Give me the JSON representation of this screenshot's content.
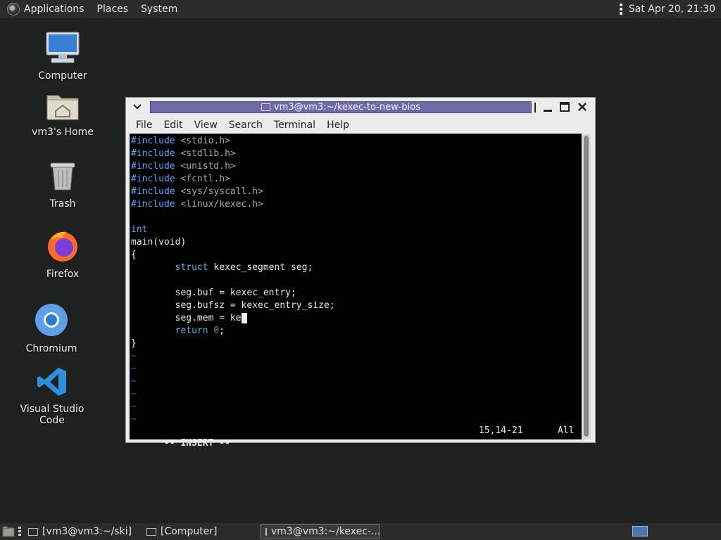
{
  "top_panel": {
    "menus": [
      "Applications",
      "Places",
      "System"
    ],
    "clock": "Sat Apr 20, 21:30"
  },
  "desktop_icons": [
    {
      "label": "Computer",
      "icon": "computer-icon"
    },
    {
      "label": "vm3's Home",
      "icon": "home-folder-icon"
    },
    {
      "label": "Trash",
      "icon": "trash-icon"
    },
    {
      "label": "Firefox",
      "icon": "firefox-icon"
    },
    {
      "label": "Chromium",
      "icon": "chromium-icon"
    },
    {
      "label": "Visual Studio Code",
      "icon": "vscode-icon"
    }
  ],
  "window": {
    "title": "vm3@vm3:~/kexec-to-new-bios",
    "menus": [
      "File",
      "Edit",
      "View",
      "Search",
      "Terminal",
      "Help"
    ]
  },
  "editor": {
    "includes": [
      "<stdio.h>",
      "<stdlib.h>",
      "<unistd.h>",
      "<fcntl.h>",
      "<sys/syscall.h>",
      "<linux/kexec.h>"
    ],
    "include_kw": "#include",
    "type_line": "int",
    "main_line": "main(void)",
    "open_brace": "{",
    "struct_kw": "struct",
    "struct_rest": " kexec_segment seg;",
    "assign_buf": "seg.buf = kexec_entry;",
    "assign_bufsz": "seg.bufsz = kexec_entry_size;",
    "assign_mem_typed": "seg.mem = ke",
    "return_kw": "return",
    "return_val": "0",
    "return_end": ";",
    "close_brace": "}",
    "tilde": "~",
    "mode": "-- INSERT --",
    "position": "15,14-21",
    "scroll": "All"
  },
  "bottom_panel": {
    "tasks": [
      "[vm3@vm3:~/ski]",
      "[Computer]",
      "vm3@vm3:~/kexec-..."
    ]
  }
}
